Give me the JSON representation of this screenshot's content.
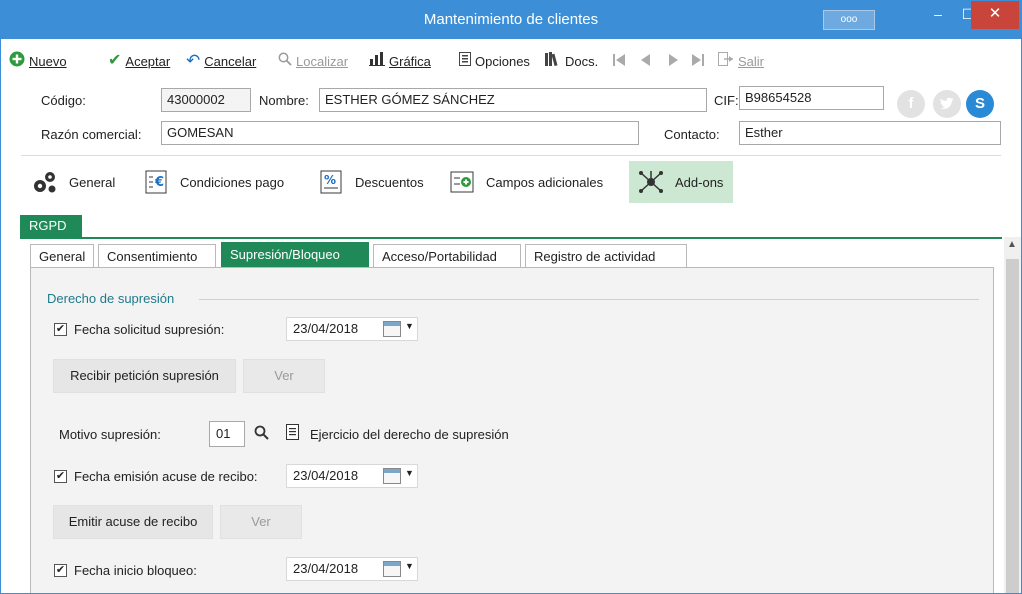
{
  "window": {
    "title": "Mantenimiento de clientes",
    "dots": "ooo",
    "min": "‒",
    "max": "☐",
    "close": "✕"
  },
  "toolbar": {
    "items": [
      {
        "label": "Nuevo",
        "icon": "plus-circle-icon",
        "enabled": true
      },
      {
        "label": "Aceptar",
        "icon": "check-icon",
        "enabled": true
      },
      {
        "label": "Cancelar",
        "icon": "undo-arrow-icon",
        "enabled": true
      },
      {
        "label": "Localizar",
        "icon": "search-icon",
        "enabled": false
      },
      {
        "label": "Gráfica",
        "icon": "bar-chart-icon",
        "enabled": true
      },
      {
        "label": "Opciones",
        "icon": "options-icon",
        "enabled": true
      },
      {
        "label": "Docs.",
        "icon": "books-icon",
        "enabled": true
      },
      {
        "label": "Salir",
        "icon": "exit-icon",
        "enabled": false
      }
    ],
    "nav_icons": [
      "first-record-icon",
      "prev-record-icon",
      "next-record-icon",
      "last-record-icon"
    ]
  },
  "header": {
    "codigo_label": "Código:",
    "codigo_value": "43000002",
    "nombre_label": "Nombre:",
    "nombre_value": "ESTHER GÓMEZ SÁNCHEZ",
    "cif_label": "CIF:",
    "cif_value": "B98654528",
    "razon_label": "Razón comercial:",
    "razon_value": "GOMESAN",
    "contacto_label": "Contacto:",
    "contacto_value": "Esther",
    "social": [
      "facebook-icon",
      "twitter-icon",
      "skype-icon"
    ]
  },
  "sections": [
    {
      "label": "General",
      "icon": "gears-icon"
    },
    {
      "label": "Condiciones pago",
      "icon": "euro-doc-icon"
    },
    {
      "label": "Descuentos",
      "icon": "percent-doc-icon"
    },
    {
      "label": "Campos adicionales",
      "icon": "add-fields-icon"
    },
    {
      "label": "Add-ons",
      "icon": "addons-network-icon",
      "active": true
    }
  ],
  "rgpd": {
    "tag": "RGPD",
    "tabs": [
      "General",
      "Consentimiento",
      "Supresión/Bloqueo",
      "Acceso/Portabilidad",
      "Registro de actividad"
    ],
    "active_tab": "Supresión/Bloqueo"
  },
  "supresion": {
    "group_title": "Derecho de supresión",
    "fecha_solicitud_label": "Fecha solicitud supresión:",
    "fecha_solicitud_value": "23/04/2018",
    "fecha_solicitud_checked": true,
    "recibir_btn": "Recibir petición supresión",
    "ver_btn": "Ver",
    "motivo_label": "Motivo supresión:",
    "motivo_code": "01",
    "motivo_desc": "Ejercicio del derecho de supresión",
    "fecha_acuse_label": "Fecha emisión acuse de recibo:",
    "fecha_acuse_value": "23/04/2018",
    "fecha_acuse_checked": true,
    "emitir_btn": "Emitir acuse de recibo",
    "ver2_btn": "Ver",
    "fecha_bloqueo_label": "Fecha inicio bloqueo:",
    "fecha_bloqueo_value": "23/04/2018",
    "fecha_bloqueo_checked": true,
    "check_mark": "✔"
  },
  "colors": {
    "titlebar": "#3c8fd6",
    "accent_green": "#1f8a58",
    "active_section": "#cce8d2"
  }
}
